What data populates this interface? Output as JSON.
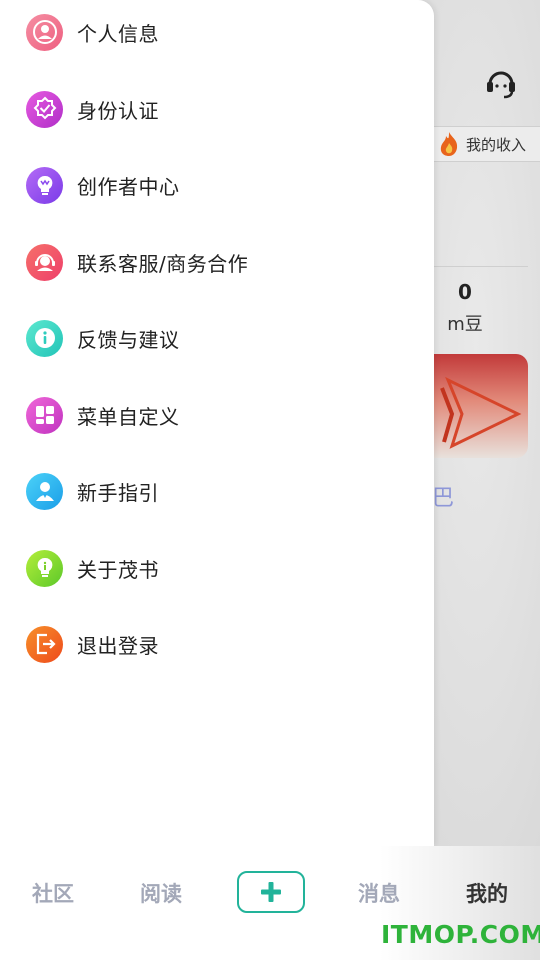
{
  "background": {
    "income_label": "我的收入",
    "stat_value": "0",
    "stat_unit": "m豆",
    "partial_glyph": "巴"
  },
  "drawer": {
    "items": [
      {
        "label": "个人信息",
        "icon": "person-icon",
        "color": "#f06a8a"
      },
      {
        "label": "身份认证",
        "icon": "verified-badge-icon",
        "color": "#d640d0"
      },
      {
        "label": "创作者中心",
        "icon": "lightbulb-crown-icon",
        "color": "#9a4ff0"
      },
      {
        "label": "联系客服/商务合作",
        "icon": "customer-service-icon",
        "color": "#f2506a"
      },
      {
        "label": "反馈与建议",
        "icon": "info-icon",
        "color": "#34d6c4"
      },
      {
        "label": "菜单自定义",
        "icon": "grid-icon",
        "color": "#e447c8"
      },
      {
        "label": "新手指引",
        "icon": "user-guide-icon",
        "color": "#2ab0f0"
      },
      {
        "label": "关于茂书",
        "icon": "bulb-info-icon",
        "color": "#8bd82a"
      },
      {
        "label": "退出登录",
        "icon": "logout-icon",
        "color": "#f26422"
      }
    ]
  },
  "tabbar": {
    "tabs": [
      {
        "label": "社区"
      },
      {
        "label": "阅读"
      },
      {
        "label": "消息"
      },
      {
        "label": "我的"
      }
    ],
    "add_icon": "plus-icon",
    "accent": "#22b39a"
  },
  "watermark": "ITMOP.COM"
}
